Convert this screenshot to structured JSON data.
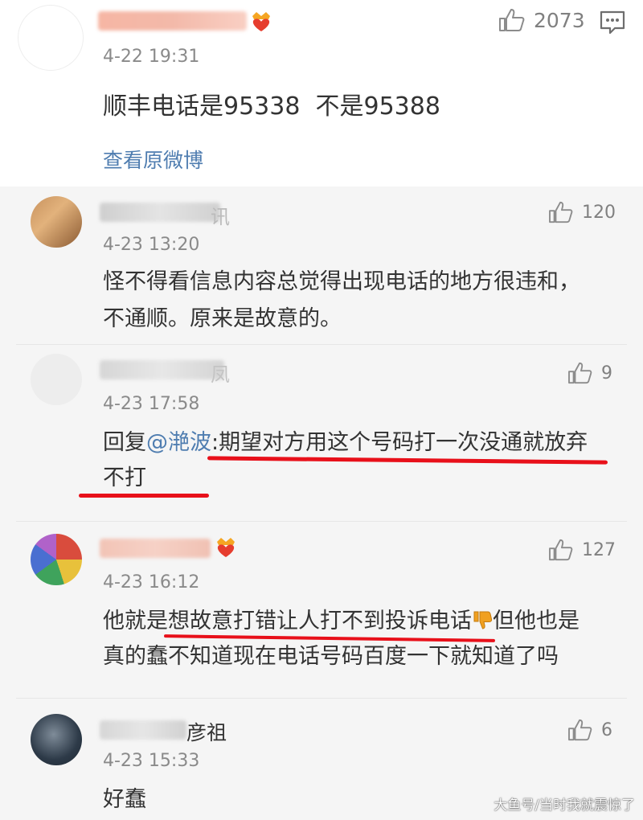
{
  "top_post": {
    "time": "4-22 19:31",
    "like_count": "2073",
    "text": "顺丰电话是95338  不是95388",
    "view_original": "查看原微博",
    "name_partial": ""
  },
  "comments": [
    {
      "name_partial": "讯",
      "time": "4-23 13:20",
      "like_count": "120",
      "line1": "怪不得看信息内容总觉得出现电话的地方很违和，",
      "line2": "不通顺。原来是故意的。"
    },
    {
      "name_partial": "凤",
      "time": "4-23 17:58",
      "like_count": "9",
      "reply_prefix": "回复",
      "mention": "@滟波",
      "line1_rest": ":期望对方用这个号码打一次没通就放弃",
      "line2": "不打"
    },
    {
      "name_partial": "",
      "time": "4-23 16:12",
      "like_count": "127",
      "line1_a": "他就是想故意打错让人打不到投诉电话",
      "line1_b": "但他也是",
      "line2": "真的蠢不知道现在电话号码百度一下就知道了吗"
    },
    {
      "name_partial": "彦祖",
      "time": "4-23 15:33",
      "like_count": "6",
      "line1": "好蠢"
    }
  ],
  "watermark": "大鱼号/当时我就震惊了",
  "icons": {
    "like": "thumbs-up-icon",
    "reply": "comment-icon",
    "badge": "heart-crown-icon",
    "dislike_emoji": "thumbs-down-emoji"
  }
}
